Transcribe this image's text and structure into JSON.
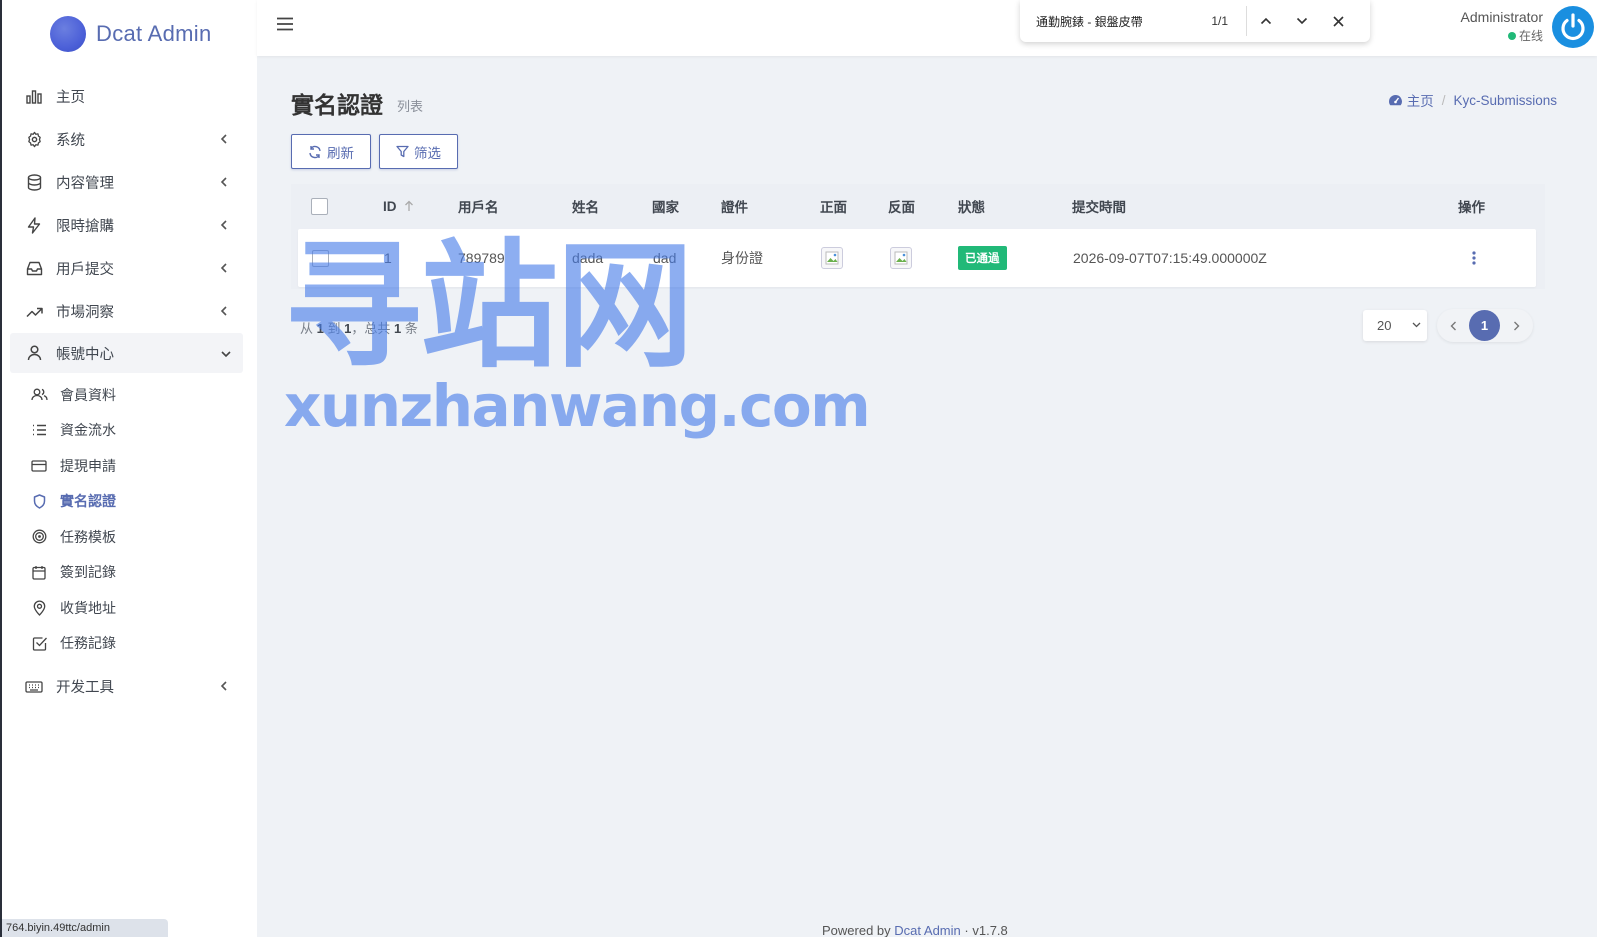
{
  "app": {
    "brand": "Dcat Admin",
    "accent_color": "#586cb1",
    "status_url": "764.biyin.49ttc/admin"
  },
  "sidebar": {
    "items": [
      {
        "label": "主页",
        "icon": "bar-chart-icon",
        "has_children": false
      },
      {
        "label": "系统",
        "icon": "gear-icon",
        "has_children": true
      },
      {
        "label": "内容管理",
        "icon": "database-icon",
        "has_children": true
      },
      {
        "label": "限時搶購",
        "icon": "lightning-icon",
        "has_children": true
      },
      {
        "label": "用戶提交",
        "icon": "inbox-icon",
        "has_children": true
      },
      {
        "label": "市場洞察",
        "icon": "trend-icon",
        "has_children": true
      },
      {
        "label": "帳號中心",
        "icon": "user-icon",
        "has_children": true,
        "expanded": true
      },
      {
        "label": "开发工具",
        "icon": "keyboard-icon",
        "has_children": true
      }
    ],
    "sub_items": [
      {
        "label": "會員資料",
        "icon": "users-icon"
      },
      {
        "label": "資金流水",
        "icon": "list-icon"
      },
      {
        "label": "提現申請",
        "icon": "card-icon"
      },
      {
        "label": "實名認證",
        "icon": "shield-icon",
        "active": true
      },
      {
        "label": "任務模板",
        "icon": "target-icon"
      },
      {
        "label": "簽到記錄",
        "icon": "calendar-icon"
      },
      {
        "label": "收貨地址",
        "icon": "map-pin-icon"
      },
      {
        "label": "任務記錄",
        "icon": "check-square-icon"
      }
    ]
  },
  "find_bar": {
    "query": "通勤腕錶 - 銀盤皮帶",
    "count": "1/1"
  },
  "user": {
    "name": "Administrator",
    "status": "在线",
    "status_color": "#21b978"
  },
  "page": {
    "title": "實名認證",
    "subtitle": "列表",
    "breadcrumb_home": "主页",
    "breadcrumb_current": "Kyc-Submissions"
  },
  "toolbar": {
    "refresh_label": "刷新",
    "filter_label": "筛选"
  },
  "table": {
    "columns": [
      "ID",
      "用戶名",
      "姓名",
      "國家",
      "證件",
      "正面",
      "反面",
      "狀態",
      "提交時間",
      "操作"
    ],
    "rows": [
      {
        "id": "1",
        "username": "789789",
        "name": "dada",
        "country": "dad",
        "document": "身份證",
        "status": "已通過",
        "submitted_at": "2026-09-07T07:15:49.000000Z"
      }
    ]
  },
  "pager": {
    "from_label": "从",
    "from": "1",
    "to_label": "到",
    "to": "1",
    "total_label": "，总共",
    "total": "1",
    "unit": "条",
    "per_page": "20",
    "current_page": "1"
  },
  "footer": {
    "powered_by": "Powered by",
    "link": "Dcat Admin",
    "version": "v1.7.8"
  },
  "watermark": {
    "cn": "寻站网",
    "en": "xunzhanwang.com"
  }
}
